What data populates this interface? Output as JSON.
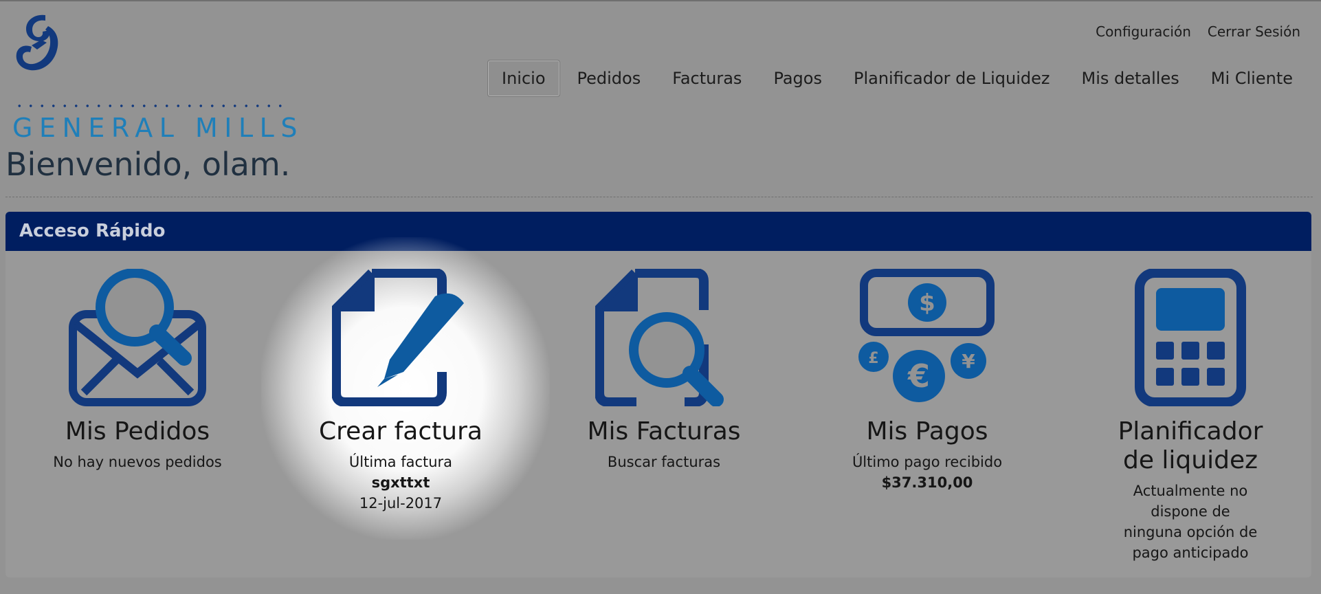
{
  "brand": {
    "logo_text": "GENERAL MILLS",
    "logo_color": "#1f7fb9",
    "logo_mark_color": "#12397d"
  },
  "utility_nav": {
    "settings": "Configuración",
    "logout": "Cerrar Sesión"
  },
  "main_nav": {
    "items": [
      {
        "label": "Inicio",
        "active": true
      },
      {
        "label": "Pedidos"
      },
      {
        "label": "Facturas"
      },
      {
        "label": "Pagos"
      },
      {
        "label": "Planificador de Liquidez"
      },
      {
        "label": "Mis detalles"
      },
      {
        "label": "Mi Cliente"
      }
    ]
  },
  "welcome": "Bienvenido, olam.",
  "quick_access": {
    "header": "Acceso Rápido",
    "header_color": "#001e60",
    "tiles": [
      {
        "icon": "envelope-search-icon",
        "title": "Mis Pedidos",
        "desc": "No hay nuevos pedidos"
      },
      {
        "icon": "document-pen-icon",
        "title": "Crear factura",
        "desc": "Última factura",
        "bold": "sgxttxt",
        "extra": "12-jul-2017"
      },
      {
        "icon": "document-search-icon",
        "title": "Mis Facturas",
        "desc": "Buscar facturas"
      },
      {
        "icon": "currency-money-icon",
        "title": "Mis Pagos",
        "desc": "Último pago recibido",
        "bold": "$37.310,00"
      },
      {
        "icon": "calculator-icon",
        "title": "Planificador de liquidez",
        "desc": "Actualmente no dispone de ninguna opción de pago anticipado"
      }
    ]
  },
  "colors": {
    "overlay_gray": "#939393",
    "icon_dark": "#12397d",
    "icon_light": "#0e5ba0"
  }
}
